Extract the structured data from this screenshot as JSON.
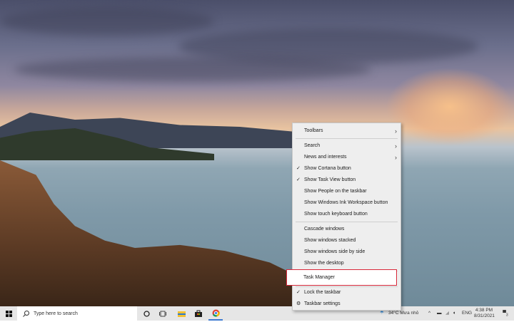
{
  "context_menu": {
    "items": [
      {
        "label": "Toolbars",
        "submenu": true,
        "checked": false
      },
      {
        "label": "Search",
        "submenu": true,
        "checked": false
      },
      {
        "label": "News and interests",
        "submenu": true,
        "checked": false
      },
      {
        "label": "Show Cortana button",
        "checked": true
      },
      {
        "label": "Show Task View button",
        "checked": true
      },
      {
        "label": "Show People on the taskbar",
        "checked": false
      },
      {
        "label": "Show Windows Ink Workspace button",
        "checked": false
      },
      {
        "label": "Show touch keyboard button",
        "checked": false
      },
      {
        "label": "Cascade windows",
        "checked": false
      },
      {
        "label": "Show windows stacked",
        "checked": false
      },
      {
        "label": "Show windows side by side",
        "checked": false
      },
      {
        "label": "Show the desktop",
        "checked": false
      },
      {
        "label": "Task Manager",
        "checked": false,
        "highlighted": true
      },
      {
        "label": "Lock the taskbar",
        "checked": true
      },
      {
        "label": "Taskbar settings",
        "icon": "gear-icon"
      }
    ],
    "highlight_color": "#d8283a"
  },
  "taskbar": {
    "search_placeholder": "Type here to search",
    "weather": "34°C",
    "weather_desc": "Mưa nhỏ",
    "language": "ENG",
    "time": "4:38 PM",
    "date": "8/31/2021",
    "notification_count": "3"
  }
}
